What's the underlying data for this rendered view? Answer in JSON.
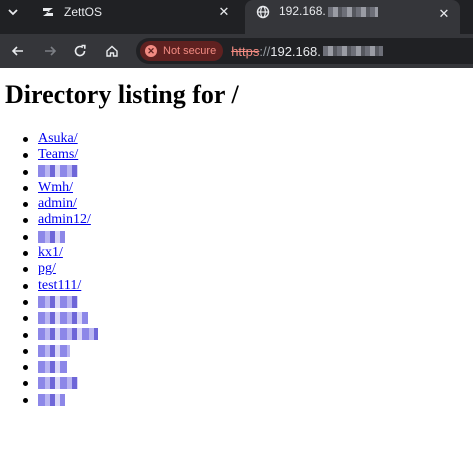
{
  "tabs": [
    {
      "title": "ZettOS",
      "active": false
    },
    {
      "title": "192.168.",
      "active": true
    }
  ],
  "toolbar": {
    "security_label": "Not secure",
    "url_scheme": "https",
    "url_sep": "://",
    "url_host": "192.168."
  },
  "page": {
    "heading": "Directory listing for /",
    "items": [
      {
        "label": "Asuka/",
        "redacted": false
      },
      {
        "label": "Teams/",
        "redacted": false
      },
      {
        "label": "",
        "redacted": true
      },
      {
        "label": "Wmh/",
        "redacted": false
      },
      {
        "label": "admin/",
        "redacted": false
      },
      {
        "label": "admin12/",
        "redacted": false
      },
      {
        "label": "",
        "redacted": true
      },
      {
        "label": "kx1/",
        "redacted": false
      },
      {
        "label": "pg/",
        "redacted": false
      },
      {
        "label": "test111/",
        "redacted": false
      },
      {
        "label": "",
        "redacted": true
      },
      {
        "label": "",
        "redacted": true
      },
      {
        "label": "",
        "redacted": true
      },
      {
        "label": "",
        "redacted": true
      },
      {
        "label": "",
        "redacted": true
      },
      {
        "label": "",
        "redacted": true
      },
      {
        "label": "",
        "redacted": true
      }
    ]
  },
  "colors": {
    "chrome_dark": "#202124",
    "chrome_toolbar": "#35363a",
    "not_secure": "#f28b82",
    "link": "#0000ee"
  }
}
